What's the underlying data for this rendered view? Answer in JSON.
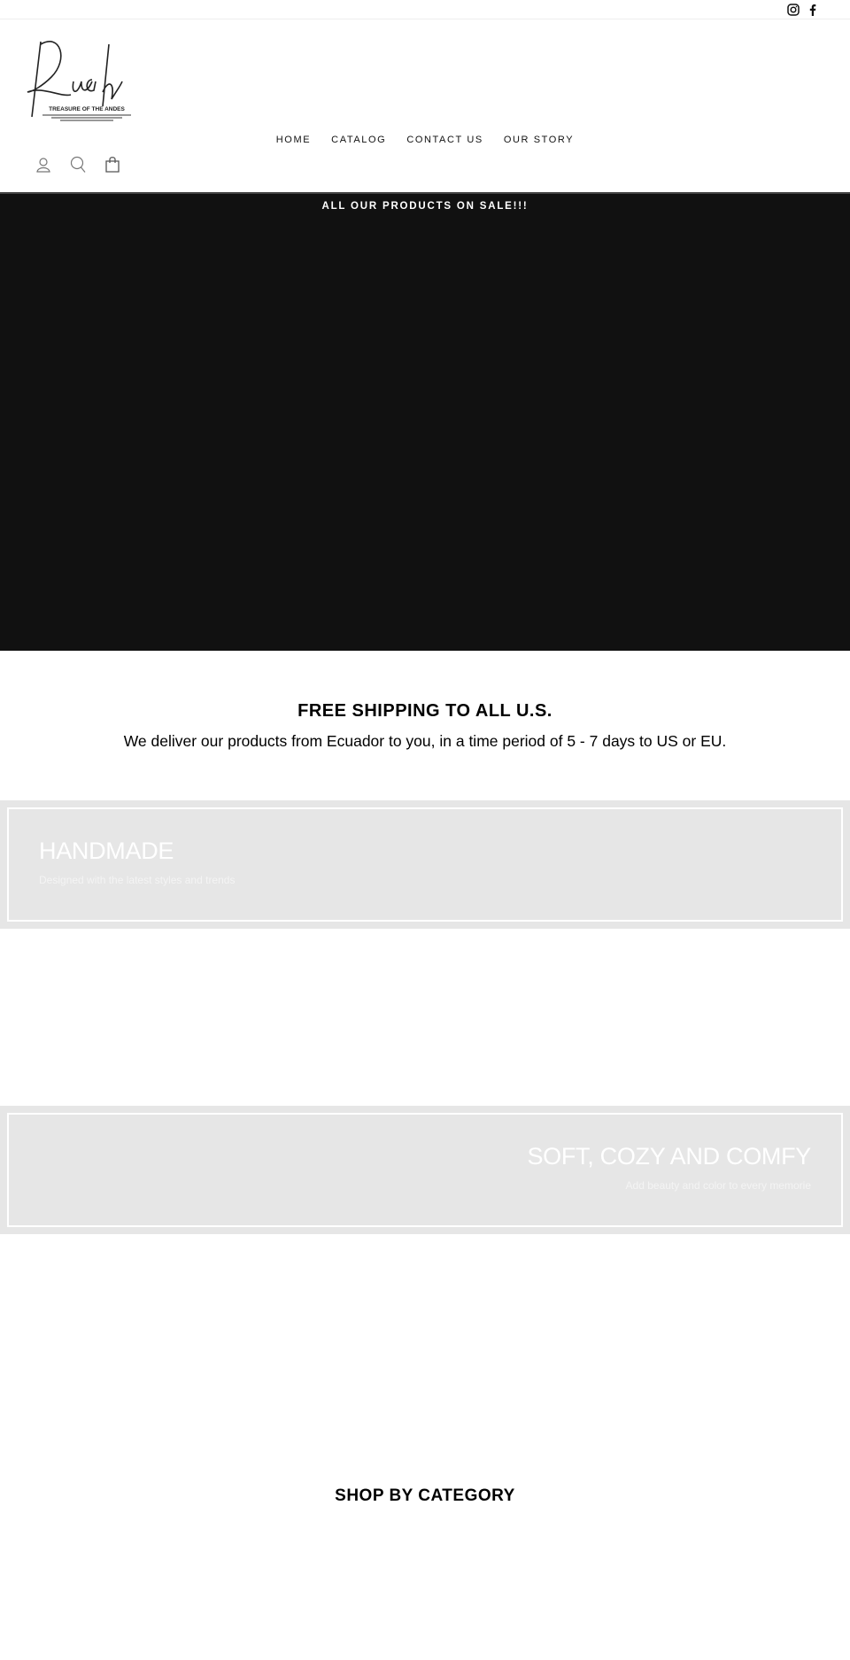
{
  "topbar": {
    "social": [
      {
        "icon": "instagram-icon"
      },
      {
        "icon": "facebook-icon"
      }
    ]
  },
  "header": {
    "logo": {
      "script_text": "Ruah",
      "tagline": "TREASURE OF THE ANDES"
    },
    "nav": [
      {
        "label": "HOME"
      },
      {
        "label": "CATALOG"
      },
      {
        "label": "CONTACT US"
      },
      {
        "label": "OUR STORY"
      }
    ],
    "icons": [
      "account-icon",
      "search-icon",
      "cart-icon"
    ]
  },
  "hero": {
    "announcement": "ALL OUR PRODUCTS ON SALE!!!",
    "background": "#111111"
  },
  "shipping": {
    "title": "FREE SHIPPING TO ALL U.S.",
    "text": "We deliver our products from Ecuador to you, in a time period of 5 - 7 days to US or EU."
  },
  "panels": [
    {
      "title": "HANDMADE",
      "subtitle": "Designed with the latest styles and trends"
    },
    {
      "title": "SOFT, COZY AND COMFY",
      "subtitle": "Add beauty and color to every memorie"
    }
  ],
  "category": {
    "title": "SHOP BY CATEGORY"
  }
}
